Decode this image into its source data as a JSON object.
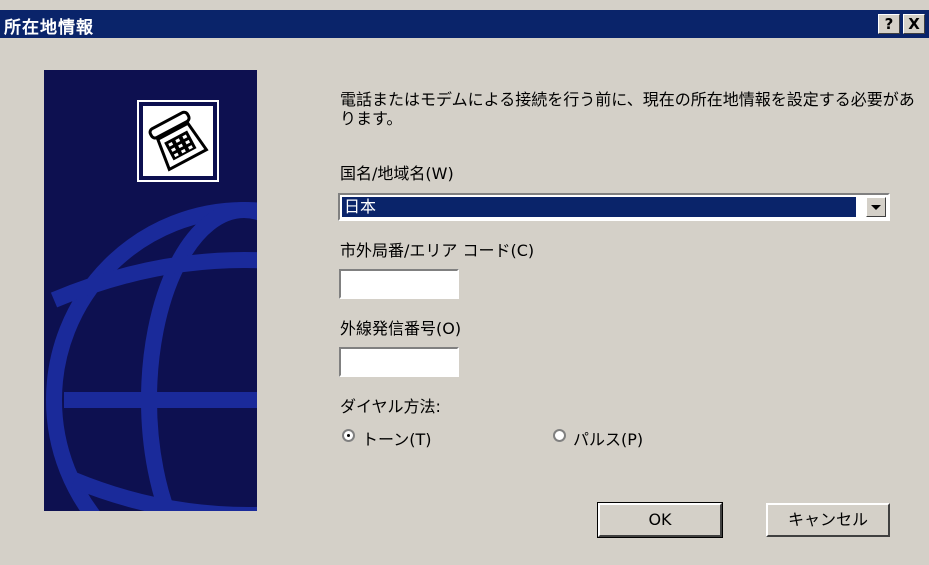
{
  "window": {
    "title": "所在地情報",
    "help_glyph": "?",
    "close_glyph": "X"
  },
  "intro_text": "電話またはモデムによる接続を行う前に、現在の所在地情報を設定する必要があります。",
  "country": {
    "label": "国名/地域名(W)",
    "selected_value": "日本"
  },
  "area_code": {
    "label": "市外局番/エリア コード(C)",
    "value": ""
  },
  "outside_line": {
    "label": "外線発信番号(O)",
    "value": ""
  },
  "dial_method": {
    "label": "ダイヤル方法:",
    "options": [
      {
        "label": "トーン(T)",
        "selected": true
      },
      {
        "label": "パルス(P)",
        "selected": false
      }
    ]
  },
  "buttons": {
    "ok": "OK",
    "cancel": "キャンセル"
  },
  "colors": {
    "titlebar": "#0a246a",
    "dialog_bg": "#d4d0c8",
    "side_panel": "#0d1050",
    "selection": "#0a246a"
  },
  "icons": [
    "telephone-icon",
    "globe-graphic",
    "help-icon",
    "close-icon",
    "dropdown-arrow-icon"
  ]
}
